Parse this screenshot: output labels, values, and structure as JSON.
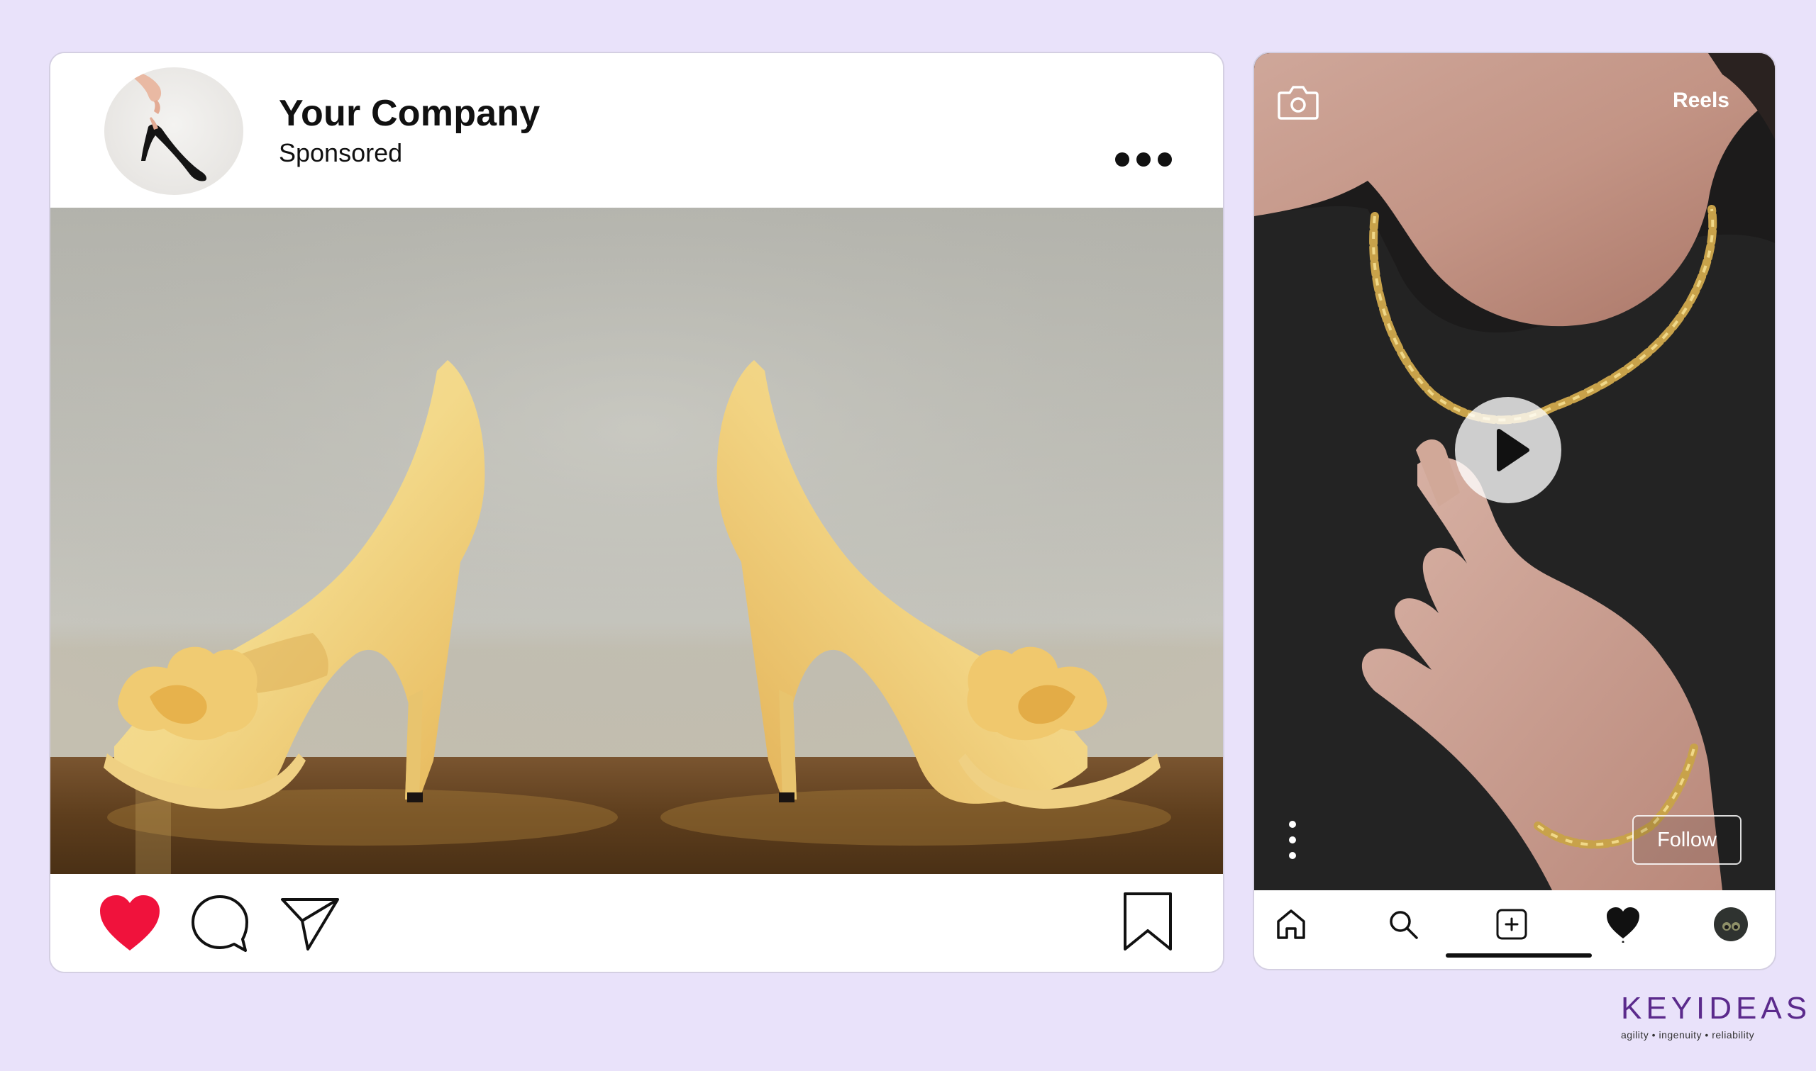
{
  "post": {
    "company_name": "Your Company",
    "sponsored_label": "Sponsored",
    "more_icon": "more-horizontal-icon",
    "image_alt": "Pair of yellow satin high heel shoes",
    "actions": {
      "like_icon": "heart-filled-icon",
      "comment_icon": "comment-icon",
      "share_icon": "send-icon",
      "save_icon": "bookmark-icon"
    },
    "like_color": "#f0123c"
  },
  "reels": {
    "title": "Reels",
    "camera_icon": "camera-icon",
    "play_icon": "play-icon",
    "more_icon": "more-vertical-icon",
    "follow_label": "Follow",
    "nav": [
      {
        "icon": "home-icon"
      },
      {
        "icon": "search-icon"
      },
      {
        "icon": "add-post-icon"
      },
      {
        "icon": "heart-icon"
      },
      {
        "icon": "profile-avatar"
      }
    ]
  },
  "brand": {
    "name": "KEYIDEAS",
    "tagline": "agility  •  ingenuity  •  reliability",
    "color": "#5b2a8c"
  },
  "colors": {
    "background": "#e9e2fa"
  }
}
